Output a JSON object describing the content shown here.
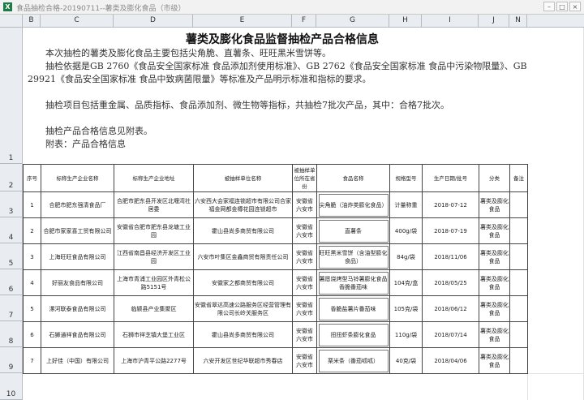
{
  "window": {
    "title": "食品抽检合格-20190711--薯类及膨化食品（市级）",
    "app_icon": "X"
  },
  "columns": [
    "B",
    "C",
    "D",
    "E",
    "F",
    "G",
    "H",
    "I",
    "J",
    "N"
  ],
  "rows": [
    "1",
    "2",
    "3",
    "4",
    "5",
    "6",
    "7",
    "8",
    "9",
    "10"
  ],
  "document": {
    "title": "薯类及膨化食品监督抽检产品合格信息",
    "paragraphs": [
      "本次抽检的薯类及膨化食品主要包括尖角脆、直薯条、旺旺黑米雪饼等。",
      "抽检依据是GB 2760《食品安全国家标准 食品添加剂使用标准》、GB 2762《食品安全国家标准 食品中污染物限量》、GB 29921《食品安全国家标准 食品中致病菌限量》等标准及产品明示标准和指标的要求。",
      "抽检项目包括重金属、品质指标、食品添加剂、微生物等指标，共抽检7批次产品，其中：合格7批次。",
      "抽检产品合格信息见附表。",
      "附表：产品合格信息"
    ]
  },
  "table": {
    "headers": [
      "序号",
      "标称生产企业名称",
      "标称生产企业地址",
      "被抽样单位名称",
      "被抽样单位所在省份",
      "食品名称",
      "规格型号",
      "生产日期/批号",
      "分类",
      "备注"
    ],
    "rows": [
      [
        "1",
        "合肥市肥东强清食品厂",
        "合肥市肥东县开发区北堰湾社居委",
        "六安西大会家福连锁超市有限公司合家福金网都金樽花园连锁超市",
        "安徽省六安市",
        "尖角脆（油炸类膨化食品）",
        "计量称重",
        "2018-07-12",
        "薯类及膨化食品",
        ""
      ],
      [
        "2",
        "合肥市家家喜工贸有限公司",
        "安徽省合肥市肥东县龙塘工业园",
        "霍山县尚多商贸有限公司",
        "安徽省六安市",
        "直薯条",
        "400g/袋",
        "2018-07-19",
        "薯类及膨化食品",
        ""
      ],
      [
        "3",
        "上海旺旺食品有限公司",
        "江西省南昌县经济开发区工业园",
        "六安市叶集区金鑫商贸有限责任公司",
        "安徽省六安市",
        "旺旺黑米雪饼（含油型膨化食品）",
        "84g/袋",
        "2018/11/06",
        "薯类及膨化食品",
        ""
      ],
      [
        "4",
        "好丽友食品有限公司",
        "上海市青浦工业园区外青松公路5151号",
        "安徽家之都商贸有限公司",
        "安徽省六安市",
        "薯愿烧烤型马铃薯膨化食品香脆番茄味",
        "104克/盒",
        "2018/05/25",
        "薯类及膨化食品",
        ""
      ],
      [
        "5",
        "漯河联泰食品有限公司",
        "临颍县产业集聚区",
        "安徽省翠达高速公路服务区经营管理有限公司长岭关服务区",
        "安徽省六安市",
        "香脆盐薯片番茄味",
        "105克/袋",
        "2018/06/12",
        "薯类及膨化食品",
        ""
      ],
      [
        "6",
        "石狮通祥食品有限公司",
        "石狮市祥芝镇大堡工业区",
        "霍山县尚多商贸有限公司",
        "安徽省六安市",
        "扭扭虾条膨化食品",
        "110g/袋",
        "2018/07/14",
        "薯类及膨化食品",
        ""
      ],
      [
        "7",
        "上好佳（中国）有限公司",
        "上海市沪青平公路2277号",
        "六安开发区世纪华联超市秀春店",
        "安徽省六安市",
        "栗米条（番茄呱呱）",
        "40克/袋",
        "2018/04/06",
        "薯类及膨化食品",
        ""
      ]
    ]
  }
}
